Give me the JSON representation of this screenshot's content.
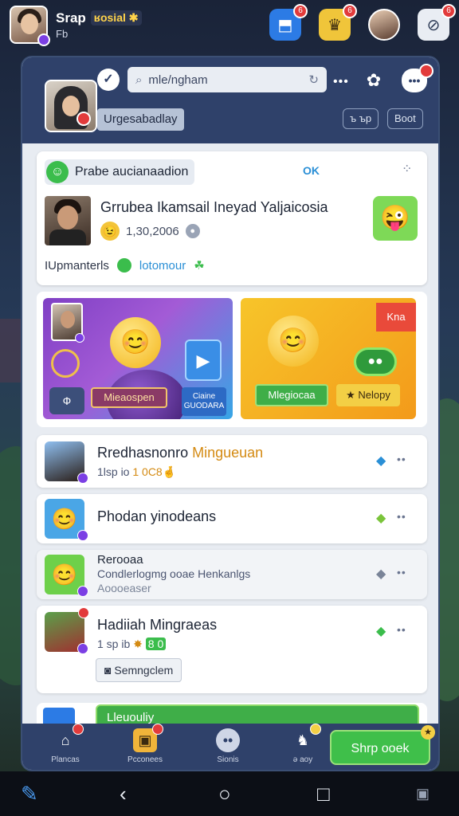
{
  "topbar": {
    "brand_name": "Srap",
    "brand_tag": "ʁosial ✱",
    "brand_sub": "Fb",
    "icons": [
      "app-icon",
      "crown-icon",
      "profile-avatar",
      "compass-icon"
    ],
    "badges": [
      "6",
      "6",
      "",
      "6"
    ]
  },
  "header": {
    "search_placeholder": "mle/ngham",
    "chip_label": "Urgesabadlay",
    "ctrl_1": "ъ ъp",
    "ctrl_2": "Boot"
  },
  "card_feature": {
    "title": "Prabe aucianaadion",
    "status": "OK",
    "name": "Grrubea Ikamsail Ineyad Yaljaicosia",
    "amount": "1,30,2006",
    "foot_label": "IUpmanterls",
    "foot_link": "lotomour"
  },
  "banner": {
    "left_btn_1": "Ф",
    "left_btn_2": "Mieaospen",
    "left_btn_3": "Ciaine GUODARA",
    "ribbon": "Kna",
    "right_btn_1": "Mlegiocaa",
    "right_btn_2": "★ Nelopy"
  },
  "list": [
    {
      "title": "Rredhasnonro",
      "title_accent": "Mingueuan",
      "sub": "1lsp io",
      "sub_accent": "1 0C8🤞"
    },
    {
      "title": "Phodan yinodeans",
      "sub": ""
    },
    {
      "title": "Rerooaa",
      "sub": "Condlerlogmg ooae Henkanlgs",
      "sub2": "Aoooeaser"
    },
    {
      "title": "Hadiiah Mingraeas",
      "sub": "1 sp ib",
      "sub_accent": "8 0",
      "tag": "Semngclem"
    }
  ],
  "peek": {
    "label": "Lleuouliy"
  },
  "nav": {
    "items": [
      "Plancas",
      "Pcconees",
      "Sionis",
      "ǝ aoy"
    ],
    "cta": "Shrp ooek"
  },
  "colors": {
    "panel_header": "#2f416a",
    "accent_green": "#3fbf4a",
    "accent_blue": "#2c7be5",
    "badge_red": "#e23b3b",
    "badge_purple": "#7b3fe4"
  }
}
